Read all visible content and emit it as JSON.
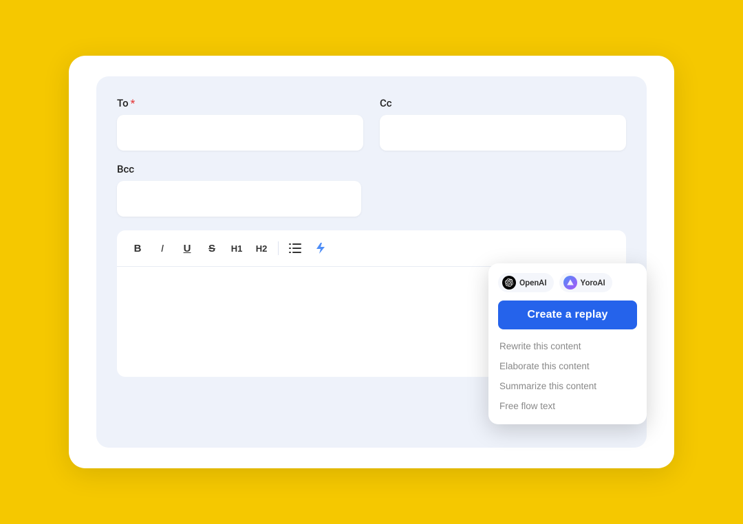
{
  "background_color": "#F5C800",
  "card": {
    "form": {
      "to_label": "To",
      "to_required": "*",
      "cc_label": "Cc",
      "bcc_label": "Bcc",
      "to_placeholder": "",
      "cc_placeholder": "",
      "bcc_placeholder": ""
    },
    "toolbar": {
      "bold_label": "B",
      "italic_label": "I",
      "underline_label": "U",
      "strikethrough_label": "S",
      "h1_label": "H1",
      "h2_label": "H2",
      "list_icon": "☰",
      "ai_icon": "⚡"
    },
    "ai_dropdown": {
      "openai_label": "OpenAI",
      "yoroai_label": "YoroAI",
      "create_replay_label": "Create a replay",
      "menu_items": [
        "Rewrite this content",
        "Elaborate this content",
        "Summarize this content",
        "Free flow text"
      ]
    }
  }
}
